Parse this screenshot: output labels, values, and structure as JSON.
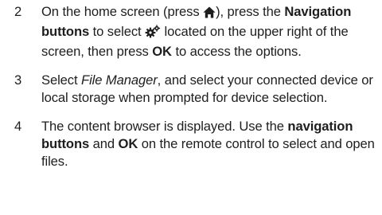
{
  "steps": [
    {
      "number": "2",
      "text": {
        "a": "On the home screen (press ",
        "b": "), press the",
        "c": "Navigation buttons",
        "d": " to select ",
        "e": " located on the upper right of the screen, then press ",
        "f": "OK",
        "g": " to access the options."
      },
      "icons": [
        "home-icon",
        "settings-gear-icon"
      ]
    },
    {
      "number": "3",
      "text": {
        "a": "Select ",
        "b": "File Manager",
        "c": ", and select your connected device or local storage when prompted for device selection."
      }
    },
    {
      "number": "4",
      "text": {
        "a": "The content browser is displayed. Use the ",
        "b": "navigation buttons",
        "c": " and ",
        "d": "OK",
        "e": " on the remote control to select and open files."
      }
    }
  ]
}
